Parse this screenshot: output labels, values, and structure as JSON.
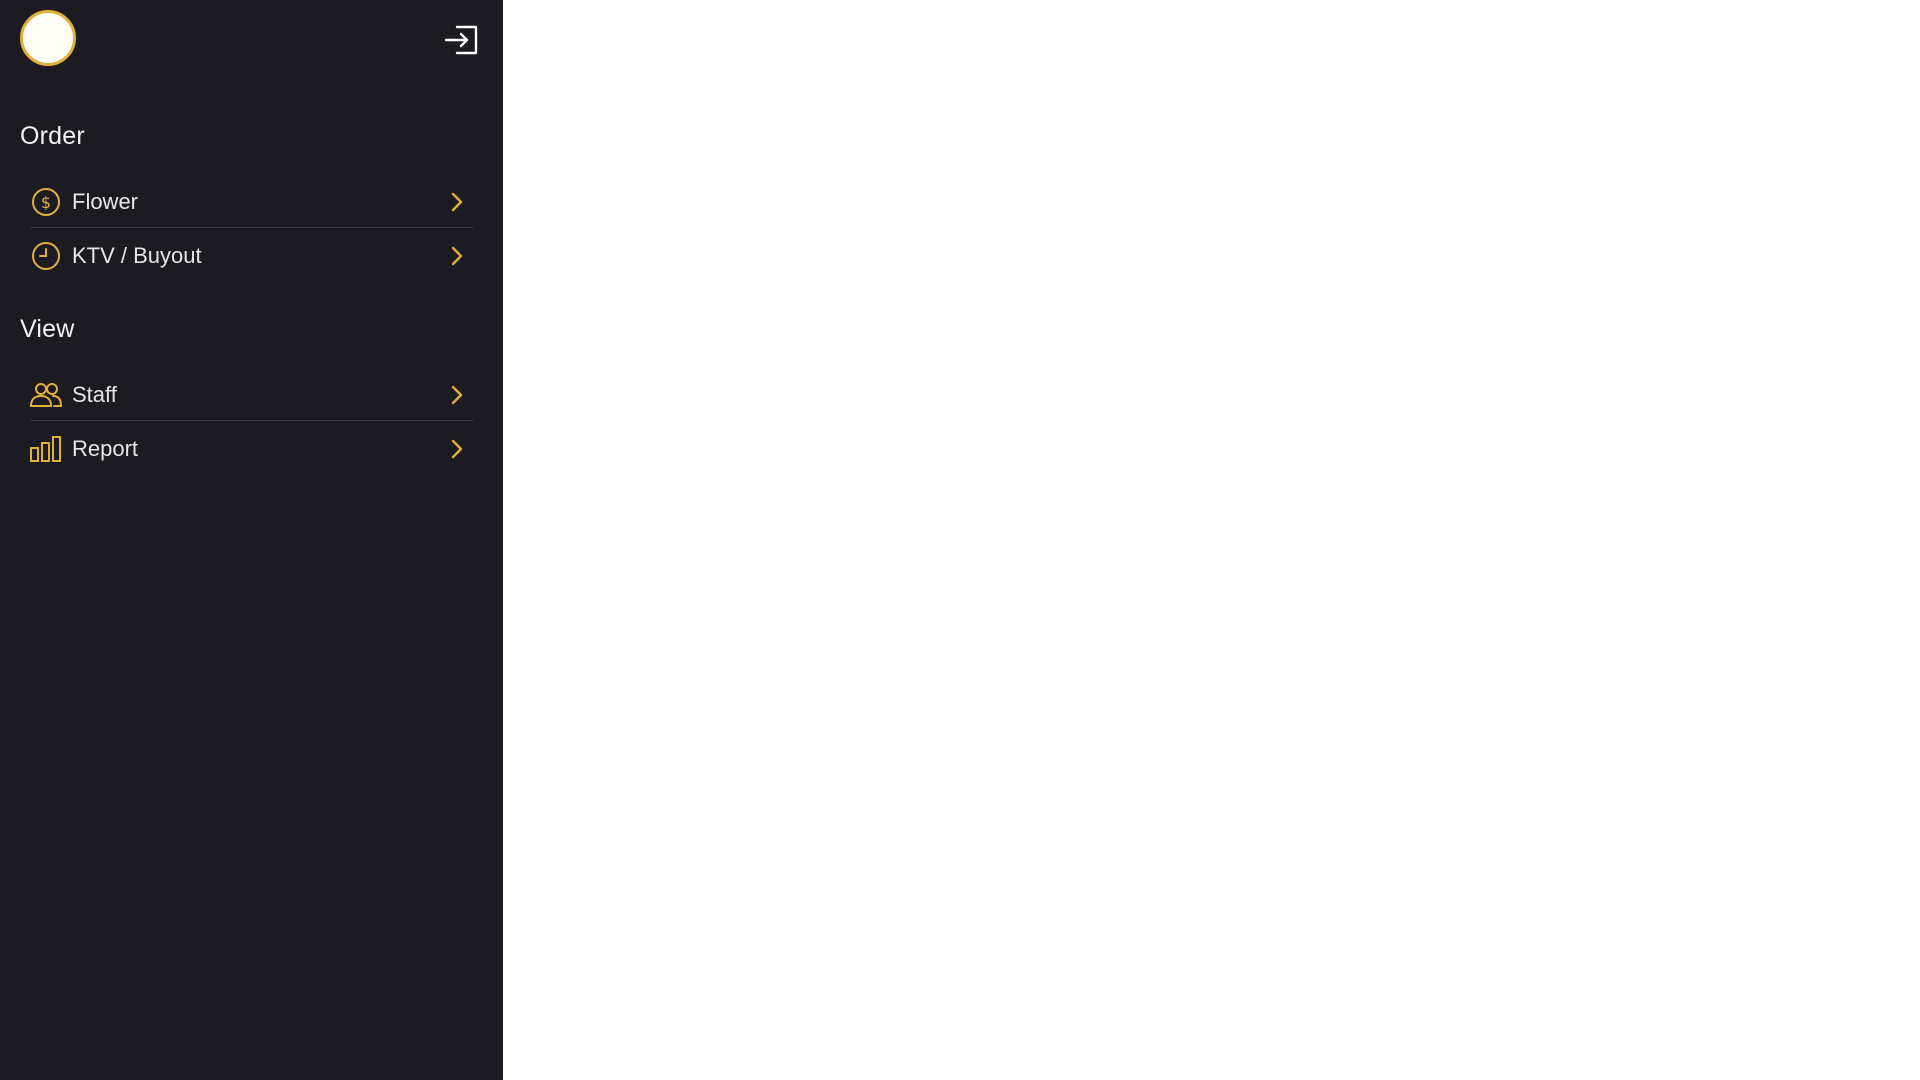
{
  "sidebar": {
    "sections": [
      {
        "title": "Order",
        "items": [
          {
            "label": "Flower",
            "icon": "dollar-circle-icon"
          },
          {
            "label": "KTV / Buyout",
            "icon": "clock-icon"
          }
        ]
      },
      {
        "title": "View",
        "items": [
          {
            "label": "Staff",
            "icon": "users-icon"
          },
          {
            "label": "Report",
            "icon": "bar-chart-icon"
          }
        ]
      }
    ]
  },
  "colors": {
    "sidebar_bg": "#1c1b21",
    "accent": "#e0b13a",
    "text": "#e6e6e6",
    "main_bg": "#ffffff"
  }
}
